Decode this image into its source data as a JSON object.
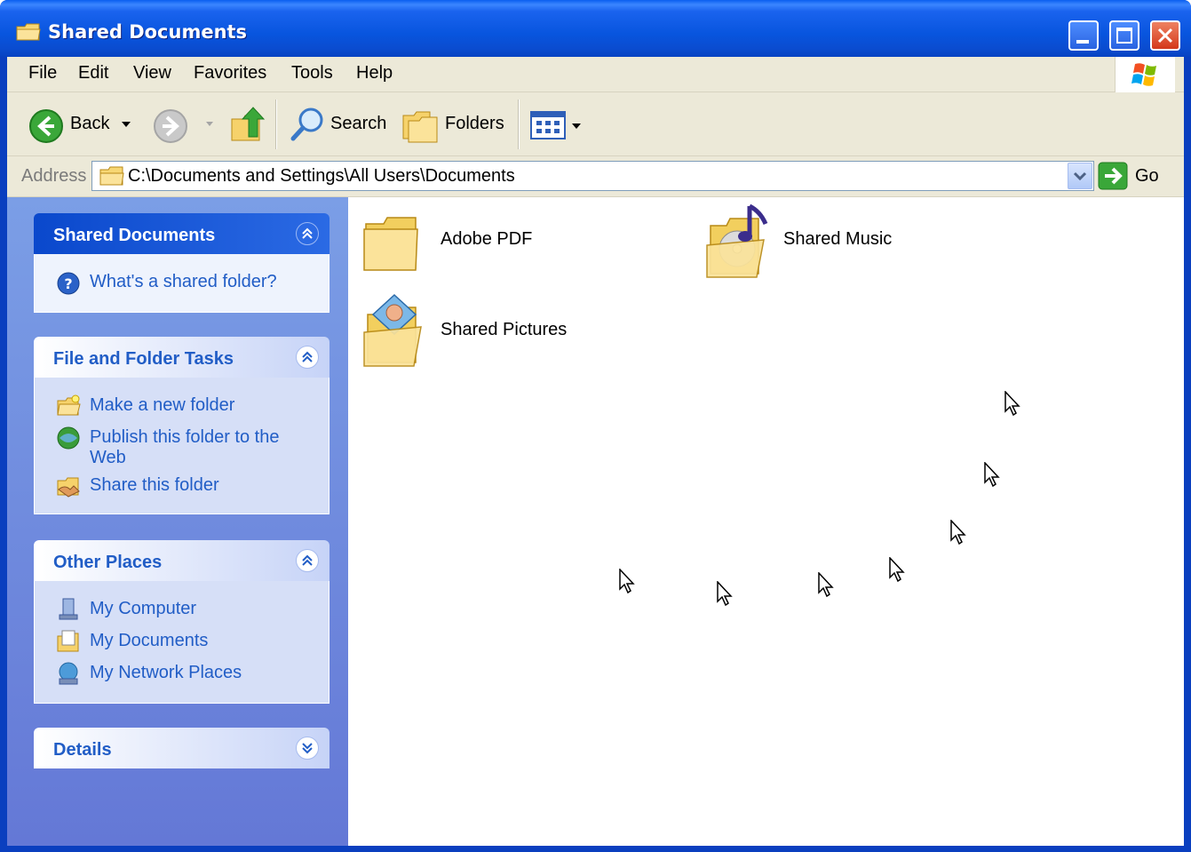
{
  "window": {
    "title": "Shared Documents",
    "accent": "#0a55de"
  },
  "menubar": {
    "items": [
      "File",
      "Edit",
      "View",
      "Favorites",
      "Tools",
      "Help"
    ]
  },
  "toolbar": {
    "back_label": "Back",
    "search_label": "Search",
    "folders_label": "Folders"
  },
  "address": {
    "label": "Address",
    "value": "C:\\Documents and Settings\\All Users\\Documents",
    "go_label": "Go"
  },
  "sidebar": {
    "panels": [
      {
        "title": "Shared Documents",
        "links": [
          "What's a shared folder?"
        ]
      },
      {
        "title": "File and Folder Tasks",
        "links": [
          "Make a new folder",
          "Publish this folder to the Web",
          "Share this folder"
        ]
      },
      {
        "title": "Other Places",
        "links": [
          "My Computer",
          "My Documents",
          "My Network Places"
        ]
      },
      {
        "title": "Details",
        "links": []
      }
    ]
  },
  "files": {
    "items": [
      {
        "name": "Adobe PDF",
        "icon": "folder-icon"
      },
      {
        "name": "Shared Music",
        "icon": "music-folder-icon"
      },
      {
        "name": "Shared Pictures",
        "icon": "pictures-folder-icon"
      }
    ]
  }
}
